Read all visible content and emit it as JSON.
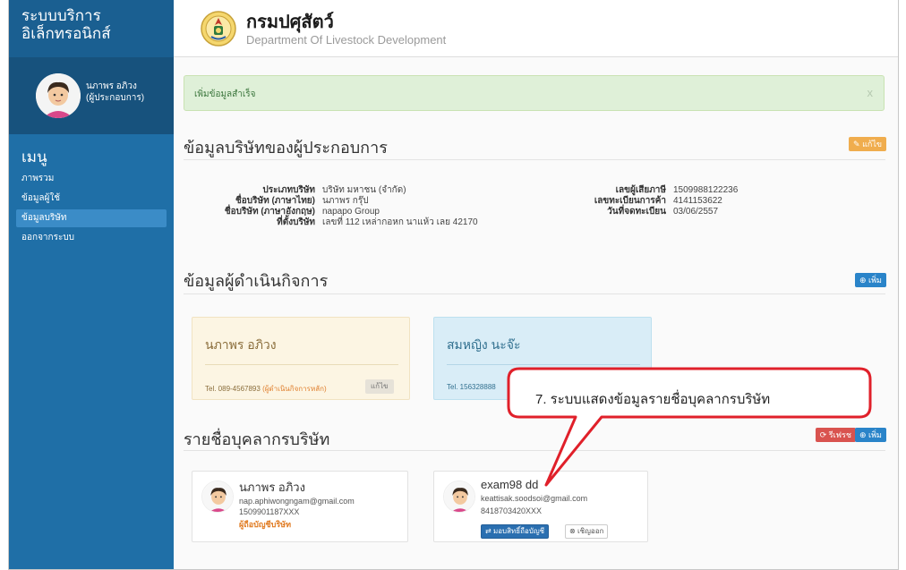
{
  "sidebar": {
    "brand_line1": "ระบบบริการ",
    "brand_line2": "อิเล็กทรอนิกส์",
    "user_name": "นภาพร อภิวง",
    "user_role": "(ผู้ประกอบการ)",
    "menu_title": "เมนู",
    "items": [
      {
        "label": "ภาพรวม",
        "active": false
      },
      {
        "label": "ข้อมูลผู้ใช้",
        "active": false
      },
      {
        "label": "ข้อมูลบริษัท",
        "active": true
      },
      {
        "label": "ออกจากระบบ",
        "active": false
      }
    ]
  },
  "header": {
    "dept_th": "กรมปศุสัตว์",
    "dept_en": "Department Of Livestock Development"
  },
  "alert": {
    "text": "เพิ่มข้อมูลสำเร็จ",
    "close": "x"
  },
  "company": {
    "title": "ข้อมูลบริษัทของผู้ประกอบการ",
    "edit_label": "แก้ไข",
    "left_fields": [
      {
        "label": "ประเภทบริษัท",
        "value": "บริษัท มหาชน (จำกัด)"
      },
      {
        "label": "ชื่อบริษัท (ภาษาไทย)",
        "value": "นภาพร กรุ๊ป"
      },
      {
        "label": "ชื่อบริษัท (ภาษาอังกฤษ)",
        "value": "napapo Group"
      },
      {
        "label": "ที่ตั้งบริษัท",
        "value": "เลขที่ 112 เหล่ากอหก นาแห้ว เลย 42170"
      }
    ],
    "right_fields": [
      {
        "label": "เลขผู้เสียภาษี",
        "value": "1509988122236"
      },
      {
        "label": "เลขทะเบียนการค้า",
        "value": "4141153622"
      },
      {
        "label": "วันที่จดทะเบียน",
        "value": "03/06/2557"
      }
    ]
  },
  "operators": {
    "title": "ข้อมูลผู้ดำเนินกิจการ",
    "add_label": "เพิ่ม",
    "cards": [
      {
        "name": "นภาพร อภิวง",
        "tel": "Tel. 089-4567893",
        "main_tag": "(ผู้ดำเนินกิจการหลัก)",
        "edit": "แก้ไข"
      },
      {
        "name": "สมหญิง นะจ๊ะ",
        "tel": "Tel. 156328888"
      }
    ]
  },
  "staff": {
    "title": "รายชื่อบุคลากรบริษัท",
    "refresh_label": "รีเฟรช",
    "add_label": "เพิ่ม",
    "people": [
      {
        "name": "นภาพร อภิวง",
        "email": "nap.aphiwongngam@gmail.com",
        "id": "1509901187XXX",
        "role": "ผู้ถือบัญชีบริษัท"
      },
      {
        "name": "exam98 dd",
        "email": "keattisak.soodsoi@gmail.com",
        "id": "8418703420XXX",
        "btn_transfer": "มอบสิทธิ์ถือบัญชี",
        "btn_remove": "เชิญออก"
      }
    ]
  },
  "callout": {
    "text": "7. ระบบแสดงข้อมูลรายชื่อบุคลากรบริษัท"
  },
  "colors": {
    "sidebar": "#1f6fa7",
    "accent_orange": "#f0ad4e",
    "accent_blue": "#2a84c9",
    "callout_border": "#e0202a"
  }
}
